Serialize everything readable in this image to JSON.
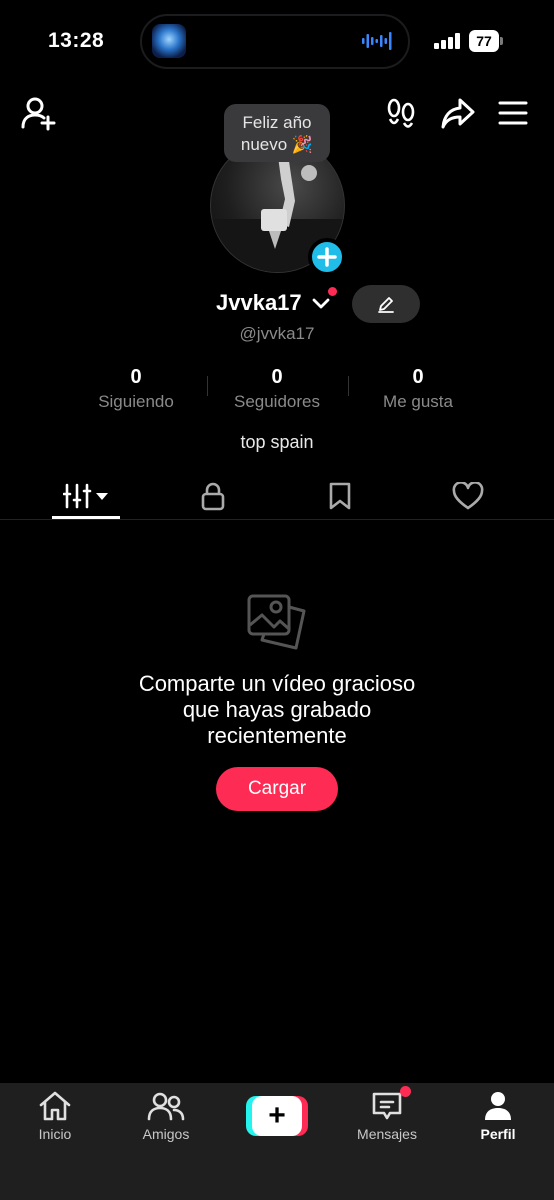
{
  "status_bar": {
    "time": "13:28",
    "battery": "77"
  },
  "profile": {
    "note_bubble": "Feliz año nuevo 🎉",
    "username": "Jvvka17",
    "handle": "@jvvka17",
    "bio": "top spain",
    "stats": [
      {
        "value": "0",
        "label": "Siguiendo"
      },
      {
        "value": "0",
        "label": "Seguidores"
      },
      {
        "value": "0",
        "label": "Me gusta"
      }
    ]
  },
  "empty_state": {
    "message_line1": "Comparte un vídeo gracioso",
    "message_line2": "que hayas grabado",
    "message_line3": "recientemente",
    "button_label": "Cargar"
  },
  "bottom_nav": {
    "items": [
      {
        "label": "Inicio",
        "icon": "home-icon"
      },
      {
        "label": "Amigos",
        "icon": "friends-icon"
      },
      {
        "label": "",
        "icon": "create-icon"
      },
      {
        "label": "Mensajes",
        "icon": "inbox-icon"
      },
      {
        "label": "Perfil",
        "icon": "profile-icon"
      }
    ]
  },
  "colors": {
    "accent_red": "#fe2c55",
    "accent_cyan": "#25f4ee",
    "plus_blue": "#20bde8"
  }
}
